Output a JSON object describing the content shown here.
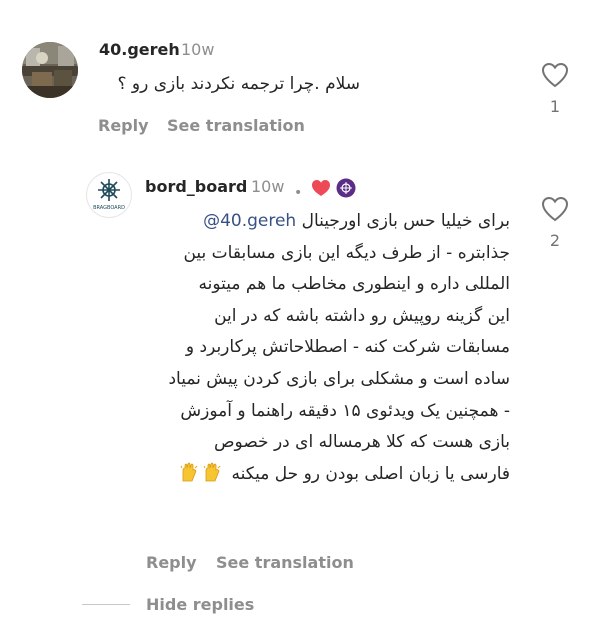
{
  "comment": {
    "username": "40.gereh",
    "time": "10w",
    "text": "سلام .چرا ترجمه نکردند بازی رو ؟",
    "like_count": "1",
    "reply_label": "Reply",
    "translate_label": "See translation"
  },
  "reply": {
    "username": "bord_board",
    "time": "10w",
    "separator": "•",
    "mention": "@40.gereh",
    "lines": [
      "برای خیلیا حس بازی اورجینال",
      "جذابتره - از طرف دیگه این بازی مسابقات بین",
      "المللی داره و اینطوری مخاطب ما هم میتونه",
      "این گزینه روپیش رو داشته باشه که در این",
      "مسابقات شرکت کنه - اصطلاحاتش پرکاربرد و",
      "ساده است و مشکلی برای بازی کردن پیش نمیاد",
      "- همچنین یک ویدئوی ۱۵ دقیقه راهنما و آموزش",
      "بازی هست که کلا هرمساله ای در خصوص",
      "فارسی یا زبان اصلی بودن رو حل میکنه"
    ],
    "avatar_text": "BRAGBOARD",
    "like_count": "2",
    "reply_label": "Reply",
    "translate_label": "See translation"
  },
  "thread": {
    "hide_replies_label": "Hide replies"
  },
  "colors": {
    "text": "#262626",
    "muted": "#8e8e8e",
    "mention": "#385185",
    "heart_red": "#ed4956",
    "badge_purple": "#5b2d86"
  },
  "icons": {
    "like": "heart-outline-icon",
    "creator_liked": "red-heart-icon",
    "creator_badge": "badge-icon",
    "emoji": "raising-hands-emoji"
  }
}
